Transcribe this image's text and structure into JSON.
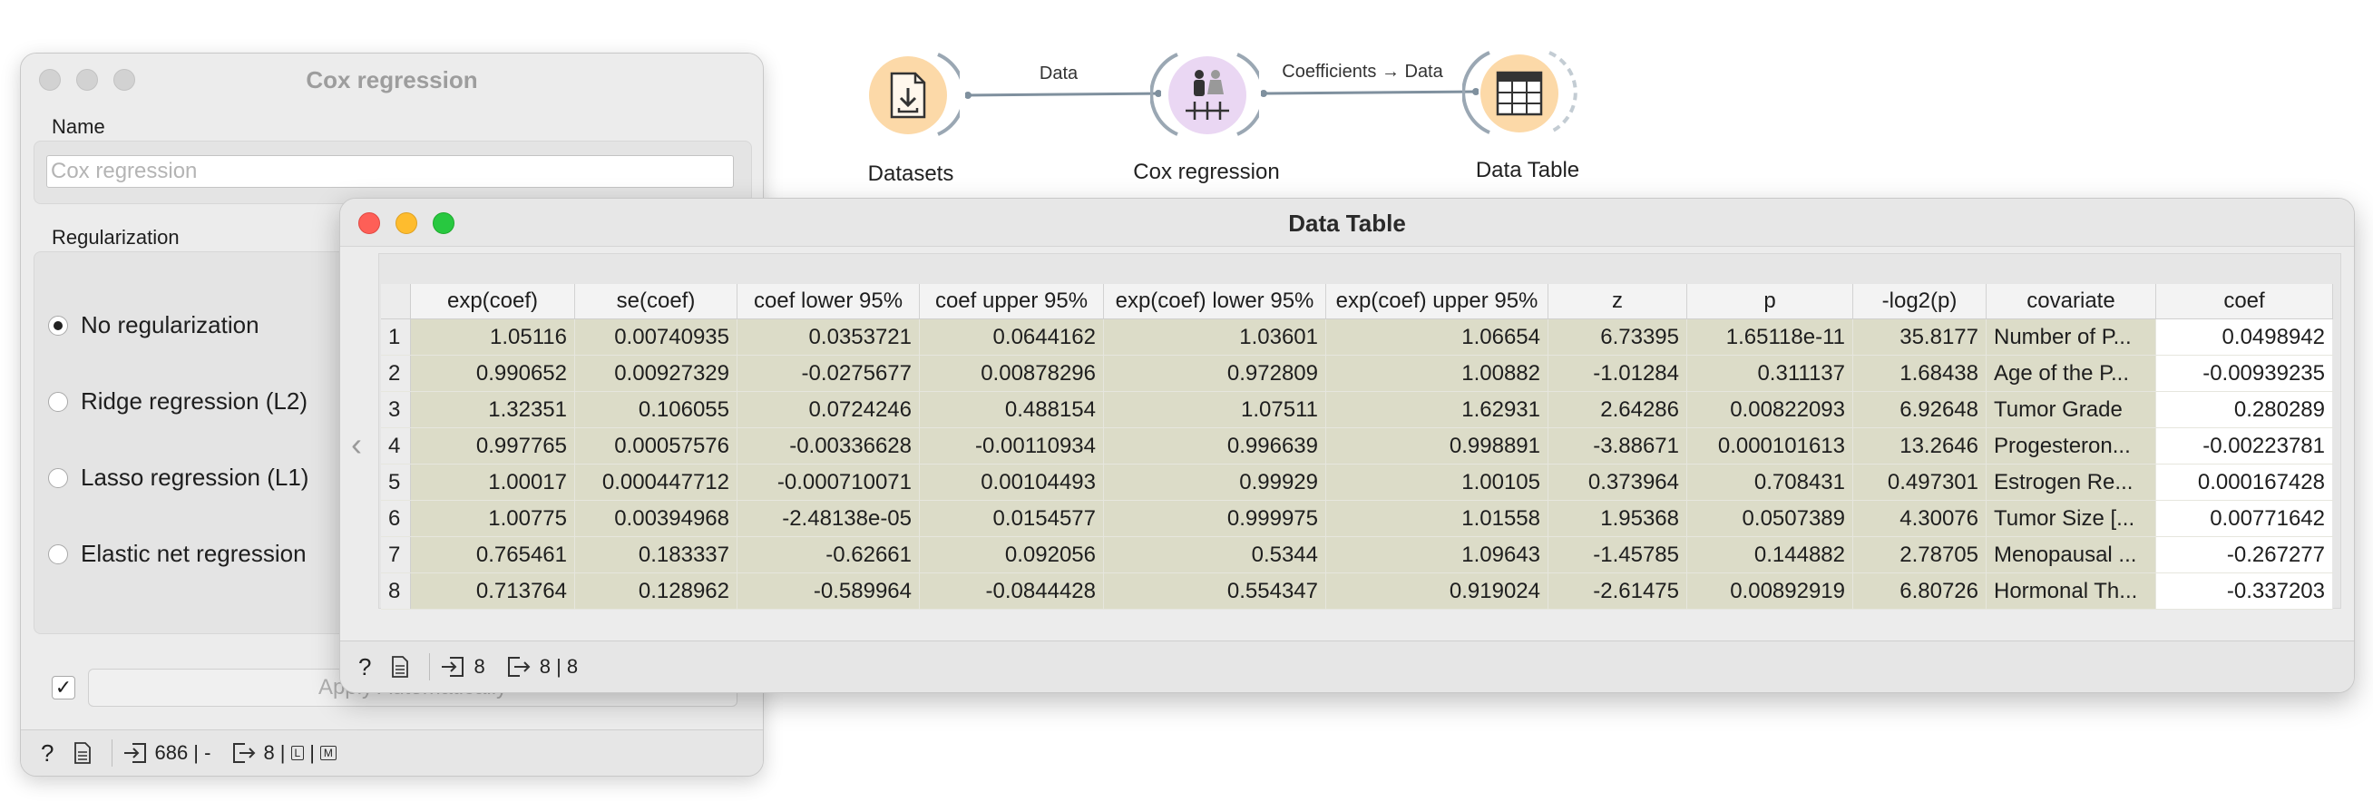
{
  "workflow": {
    "nodes": [
      {
        "label": "Datasets",
        "icon": "dataset-download-icon",
        "color": "#fcd9a8"
      },
      {
        "label": "Cox regression",
        "icon": "survival-people-icon",
        "color": "#ead7f3"
      },
      {
        "label": "Data Table",
        "icon": "table-grid-icon",
        "color": "#fcd9a8"
      }
    ],
    "links": [
      {
        "label": "Data"
      },
      {
        "label": "Coefficients → Data"
      }
    ]
  },
  "cox_window": {
    "title": "Cox regression",
    "name_label": "Name",
    "name_value": "Cox regression",
    "regularization_label": "Regularization",
    "options": [
      "No regularization",
      "Ridge regression (L2)",
      "Lasso regression (L1)",
      "Elastic net regression"
    ],
    "selected_option": 0,
    "apply_checked": "✓",
    "apply_label": "Apply Automatically",
    "status_input": "686 | -",
    "status_output": "8 |",
    "status_badge_l": "L",
    "status_badge_m": "M"
  },
  "data_table_window": {
    "title": "Data Table",
    "columns": [
      "exp(coef)",
      "se(coef)",
      "coef lower 95%",
      "coef upper 95%",
      "exp(coef) lower 95%",
      "exp(coef) upper 95%",
      "z",
      "p",
      "-log2(p)",
      "covariate",
      "coef"
    ],
    "rows": [
      [
        "1.05116",
        "0.00740935",
        "0.0353721",
        "0.0644162",
        "1.03601",
        "1.06654",
        "6.73395",
        "1.65118e-11",
        "35.8177",
        "Number of P...",
        "0.0498942"
      ],
      [
        "0.990652",
        "0.00927329",
        "-0.0275677",
        "0.00878296",
        "0.972809",
        "1.00882",
        "-1.01284",
        "0.311137",
        "1.68438",
        "Age of the P...",
        "-0.00939235"
      ],
      [
        "1.32351",
        "0.106055",
        "0.0724246",
        "0.488154",
        "1.07511",
        "1.62931",
        "2.64286",
        "0.00822093",
        "6.92648",
        "Tumor Grade",
        "0.280289"
      ],
      [
        "0.997765",
        "0.00057576",
        "-0.00336628",
        "-0.00110934",
        "0.996639",
        "0.998891",
        "-3.88671",
        "0.000101613",
        "13.2646",
        "Progesteron...",
        "-0.00223781"
      ],
      [
        "1.00017",
        "0.000447712",
        "-0.000710071",
        "0.00104493",
        "0.99929",
        "1.00105",
        "0.373964",
        "0.708431",
        "0.497301",
        "Estrogen Re...",
        "0.000167428"
      ],
      [
        "1.00775",
        "0.00394968",
        "-2.48138e-05",
        "0.0154577",
        "0.999975",
        "1.01558",
        "1.95368",
        "0.0507389",
        "4.30076",
        "Tumor Size [...",
        "0.00771642"
      ],
      [
        "0.765461",
        "0.183337",
        "-0.62661",
        "0.092056",
        "0.5344",
        "1.09643",
        "-1.45785",
        "0.144882",
        "2.78705",
        "Menopausal ...",
        "-0.267277"
      ],
      [
        "0.713764",
        "0.128962",
        "-0.589964",
        "-0.0844428",
        "0.554347",
        "0.919024",
        "-2.61475",
        "0.00892919",
        "6.80726",
        "Hormonal Th...",
        "-0.337203"
      ]
    ],
    "status_input": "8",
    "status_output": "8 | 8"
  }
}
